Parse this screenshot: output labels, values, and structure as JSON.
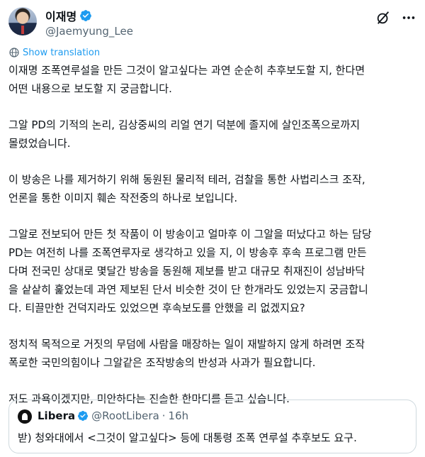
{
  "author": {
    "display_name": "이재명",
    "handle": "@Jaemyung_Lee",
    "verified_icon": "verified-badge-icon"
  },
  "header_icons": [
    "grok-icon",
    "more-icon"
  ],
  "translation": {
    "label": "Show translation",
    "icon": "globe-icon"
  },
  "tweet": {
    "paragraphs": [
      "이재명 조폭연루설을 만든 그것이 알고싶다는 과연 순순히 추후보도할 지, 한다면\n어떤 내용으로 보도할 지 궁금합니다.",
      "그알 PD의 기적의 논리, 김상중씨의 리얼 연기 덕분에 졸지에 살인조폭으로까지\n몰렸었습니다.",
      "이 방송은 나를 제거하기 위해 동원된 물리적 테러, 검찰을 통한 사법리스크 조작,\n언론을 통한 이미지 훼손 작전중의 하나로 보입니다.",
      "그알로 전보되어 만든 첫 작품이 이 방송이고 얼마후 이 그알을 떠났다고 하는 담당\nPD는 여전히 나를 조폭연루자로 생각하고 있을 지, 이 방송후 후속 프로그램 만든\n다며 전국민 상대로 몇달간 방송을 동원해 제보를 받고 대규모 취재진이 성남바닥\n을 샅샅히 훑었는데 과연 제보된 단서 비슷한 것이 단 한개라도 있었는지 궁금합니\n다. 티끌만한 건덕지라도 있었으면 후속보도를 안했을 리 없겠지요?",
      "정치적 목적으로 거짓의 무덤에 사람을 매장하는 일이 재발하지 않게 하려면 조작\n폭로한 국민의힘이나 그알같은 조작방송의 반성과 사과가 필요합니다.",
      "저도 과욕이겠지만, 미안하다는 진솔한 한마디를 듣고 싶습니다."
    ]
  },
  "quote": {
    "display_name": "Libera",
    "handle": "@RootLibera",
    "separator": "·",
    "time": "16h",
    "text": "받) 청와대에서 <그것이 알고싶다> 등에 대통령 조폭 연루설 추후보도 요구."
  },
  "colors": {
    "accent": "#1d9bf0",
    "text": "#0f1419",
    "muted": "#536471",
    "border": "#cfd9de"
  }
}
